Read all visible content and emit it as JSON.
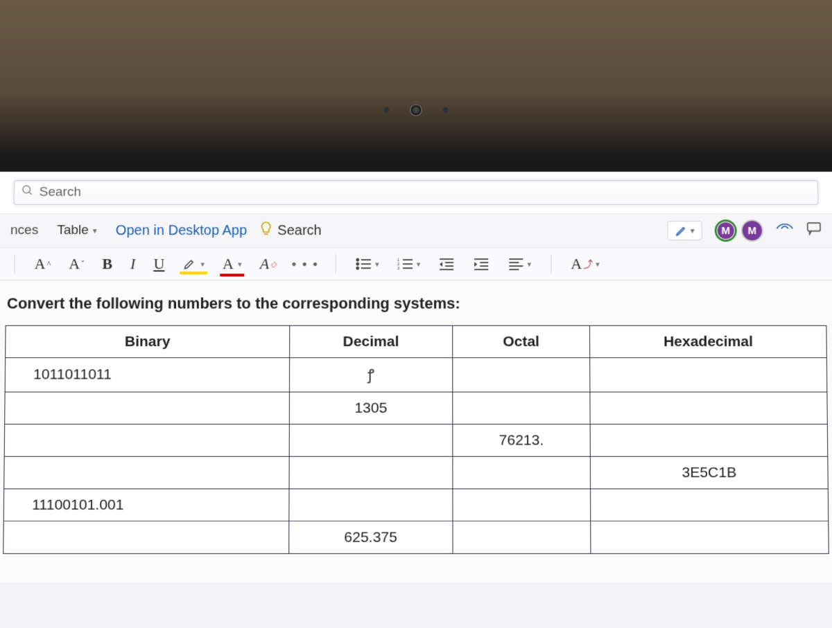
{
  "search": {
    "placeholder": "Search"
  },
  "ribbon1": {
    "tab_partial": "nces",
    "tab_table": "Table",
    "open_desktop": "Open in Desktop App",
    "search_link": "Search",
    "avatar_letter_1": "M",
    "avatar_letter_2": "M"
  },
  "ribbon2": {
    "grow": "A^",
    "shrink": "Aˇ",
    "bold": "B",
    "italic": "I",
    "underline": "U",
    "highlight": "A",
    "font_color": "A",
    "clear_format": "A",
    "ellipsis": "• • •",
    "styles": "A"
  },
  "document": {
    "heading": "Convert the following numbers to the corresponding systems:",
    "headers": {
      "binary": "Binary",
      "decimal": "Decimal",
      "octal": "Octal",
      "hex": "Hexadecimal"
    },
    "rows": [
      {
        "binary": "1011011011",
        "decimal": "",
        "octal": "",
        "hex": ""
      },
      {
        "binary": "",
        "decimal": "1305",
        "octal": "",
        "hex": ""
      },
      {
        "binary": "",
        "decimal": "",
        "octal": "76213.",
        "hex": ""
      },
      {
        "binary": "",
        "decimal": "",
        "octal": "",
        "hex": "3E5C1B"
      },
      {
        "binary": "11100101.001",
        "decimal": "",
        "octal": "",
        "hex": ""
      },
      {
        "binary": "",
        "decimal": "625.375",
        "octal": "",
        "hex": ""
      }
    ]
  }
}
